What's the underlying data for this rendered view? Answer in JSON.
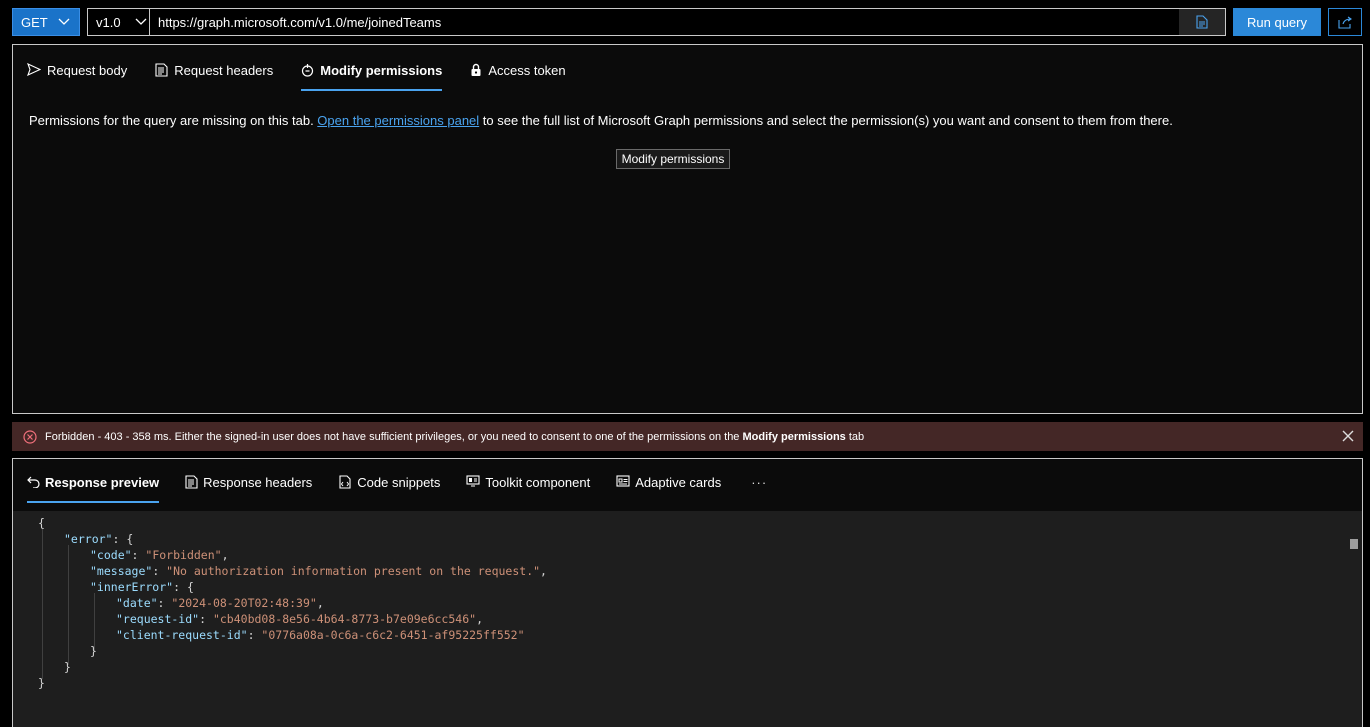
{
  "query": {
    "method": "GET",
    "version": "v1.0",
    "url": "https://graph.microsoft.com/v1.0/me/joinedTeams",
    "run_label": "Run query"
  },
  "request_tabs": [
    {
      "label": "Request body",
      "icon": "send-icon"
    },
    {
      "label": "Request headers",
      "icon": "document-icon"
    },
    {
      "label": "Modify permissions",
      "icon": "shield-icon",
      "active": true
    },
    {
      "label": "Access token",
      "icon": "lock-icon"
    }
  ],
  "permissions": {
    "msg_before": "Permissions for the query are missing on this tab. ",
    "link": "Open the permissions panel",
    "msg_after": " to see the full list of Microsoft Graph permissions and select the permission(s) you want and consent to them from there.",
    "button": "Modify permissions"
  },
  "error_bar": {
    "text": "Forbidden - 403 - 358 ms. Either the signed-in user does not have sufficient privileges, or you need to consent to one of the permissions on the ",
    "bold": "Modify permissions",
    "suffix": " tab"
  },
  "response_tabs": [
    {
      "label": "Response preview",
      "icon": "back-arrow-icon",
      "active": true
    },
    {
      "label": "Response headers",
      "icon": "document-icon"
    },
    {
      "label": "Code snippets",
      "icon": "code-icon"
    },
    {
      "label": "Toolkit component",
      "icon": "toolkit-icon"
    },
    {
      "label": "Adaptive cards",
      "icon": "card-icon"
    }
  ],
  "more_label": "···",
  "response_json": {
    "open": "{",
    "error_key": "\"error\"",
    "code_key": "\"code\"",
    "code_val": "\"Forbidden\"",
    "message_key": "\"message\"",
    "message_val": "\"No authorization information present on the request.\"",
    "inner_key": "\"innerError\"",
    "date_key": "\"date\"",
    "date_val": "\"2024-08-20T02:48:39\"",
    "reqid_key": "\"request-id\"",
    "reqid_val": "\"cb40bd08-8e56-4b64-8773-b7e09e6cc546\"",
    "clientid_key": "\"client-request-id\"",
    "clientid_val": "\"0776a08a-0c6a-c6c2-6451-af95225ff552\"",
    "close": "}"
  },
  "colors": {
    "accent": "#2b88d8",
    "error_bg": "#442726",
    "json_key": "#9cdcfe",
    "json_string": "#ce9178"
  }
}
